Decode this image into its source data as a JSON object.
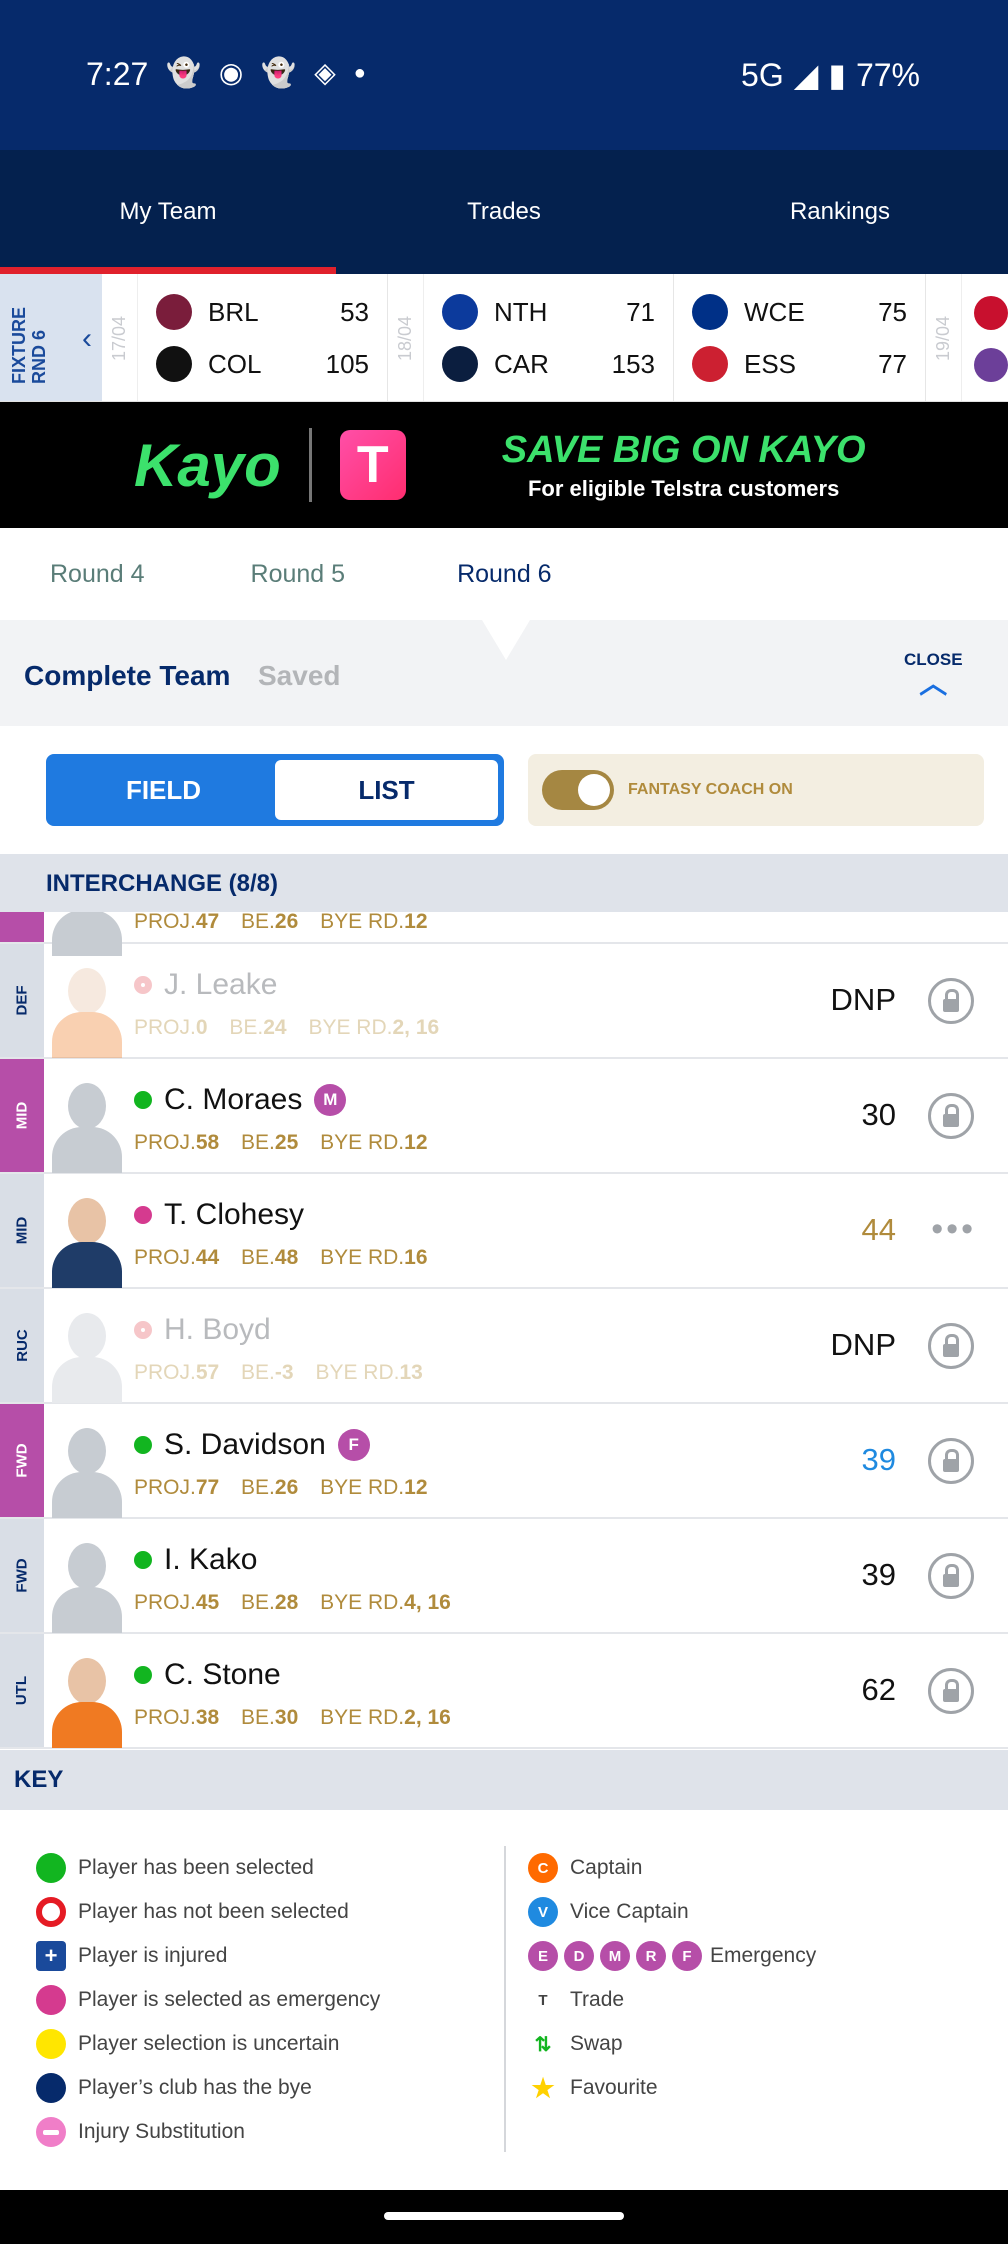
{
  "status": {
    "time": "7:27",
    "network": "5G",
    "battery": "77%",
    "icons": [
      "snapchat-icon",
      "messenger-icon",
      "snapchat-icon",
      "discord-icon",
      "dot-icon"
    ]
  },
  "tabs": [
    {
      "label": "My Team",
      "active": true
    },
    {
      "label": "Trades",
      "active": false
    },
    {
      "label": "Rankings",
      "active": false
    }
  ],
  "fixture": {
    "label": "FIXTURE RND 6",
    "dates": [
      "17/04",
      "18/04",
      "19/04"
    ],
    "matches": [
      {
        "home": {
          "abbr": "BRL",
          "score": "53",
          "color": "#7a1d3b"
        },
        "away": {
          "abbr": "COL",
          "score": "105",
          "color": "#111111"
        }
      },
      {
        "home": {
          "abbr": "NTH",
          "score": "71",
          "color": "#0c3a9c"
        },
        "away": {
          "abbr": "CAR",
          "score": "153",
          "color": "#0b1e3f"
        }
      },
      {
        "home": {
          "abbr": "WCE",
          "score": "75",
          "color": "#003087"
        },
        "away": {
          "abbr": "ESS",
          "score": "77",
          "color": "#cc2031"
        }
      }
    ]
  },
  "banner": {
    "brand": "Kayo",
    "partner": "T",
    "headline": "SAVE BIG ON KAYO",
    "subline": "For eligible Telstra customers"
  },
  "rounds": [
    "Round 4",
    "Round 5",
    "Round 6"
  ],
  "team_status": {
    "title": "Complete Team",
    "state": "Saved",
    "close": "CLOSE"
  },
  "view": {
    "field": "FIELD",
    "list": "LIST",
    "coach": "FANTASY COACH ON"
  },
  "section": "INTERCHANGE (8/8)",
  "partial_row": {
    "proj": "47",
    "be": "26",
    "bye": "12"
  },
  "players": [
    {
      "pos": "DEF",
      "name": "J. Leake",
      "status": "not-selected",
      "badge": "",
      "proj": "0",
      "be": "24",
      "bye": "2, 16",
      "score": "DNP",
      "action": "lock"
    },
    {
      "pos": "MID",
      "name": "C. Moraes",
      "status": "selected",
      "badge": "M",
      "proj": "58",
      "be": "25",
      "bye": "12",
      "score": "30",
      "action": "lock"
    },
    {
      "pos": "MID",
      "name": "T. Clohesy",
      "status": "emergency",
      "badge": "",
      "proj": "44",
      "be": "48",
      "bye": "16",
      "score": "44",
      "action": "more"
    },
    {
      "pos": "RUC",
      "name": "H. Boyd",
      "status": "not-selected",
      "badge": "",
      "proj": "57",
      "be": "-3",
      "bye": "13",
      "score": "DNP",
      "action": "lock"
    },
    {
      "pos": "FWD",
      "name": "S. Davidson",
      "status": "selected",
      "badge": "F",
      "proj": "77",
      "be": "26",
      "bye": "12",
      "score": "39",
      "action": "lock"
    },
    {
      "pos": "FWD",
      "name": "I. Kako",
      "status": "selected",
      "badge": "",
      "proj": "45",
      "be": "28",
      "bye": "4, 16",
      "score": "39",
      "action": "lock"
    },
    {
      "pos": "UTL",
      "name": "C. Stone",
      "status": "selected",
      "badge": "",
      "proj": "38",
      "be": "30",
      "bye": "2, 16",
      "score": "62",
      "action": "lock"
    }
  ],
  "labels": {
    "proj": "PROJ.",
    "be": "BE.",
    "bye": "BYE RD."
  },
  "key": {
    "title": "KEY",
    "left": [
      "Player has been selected",
      "Player has not been selected",
      "Player is injured",
      "Player is selected as emergency",
      "Player selection is uncertain",
      "Player’s club has the bye",
      "Injury Substitution"
    ],
    "right": {
      "captain": "Captain",
      "vice": "Vice Captain",
      "emergency": "Emergency",
      "emergency_letters": [
        "E",
        "D",
        "M",
        "R",
        "F"
      ],
      "trade": "Trade",
      "swap": "Swap",
      "favourite": "Favourite",
      "captain_letter": "C",
      "vice_letter": "V",
      "trade_letter": "T"
    }
  }
}
